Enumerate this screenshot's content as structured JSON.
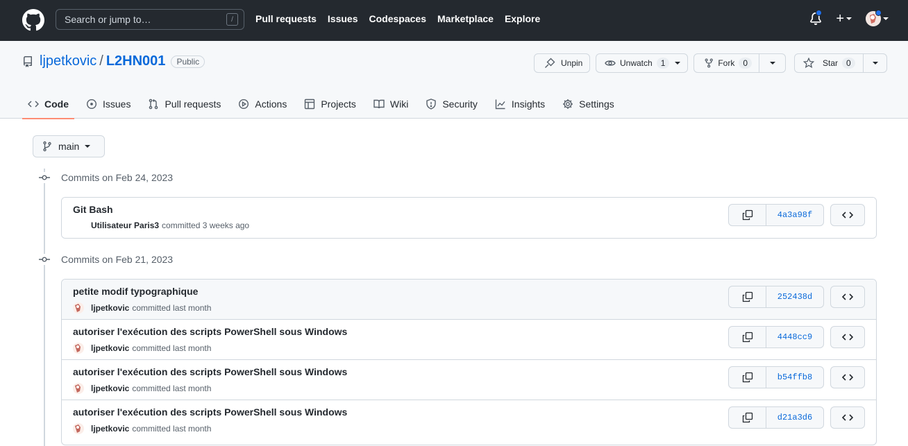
{
  "header": {
    "search_placeholder": "Search or jump to…",
    "search_key": "/",
    "nav": [
      "Pull requests",
      "Issues",
      "Codespaces",
      "Marketplace",
      "Explore"
    ]
  },
  "repo": {
    "owner": "ljpetkovic",
    "separator": "/",
    "name": "L2HN001",
    "visibility": "Public",
    "unpin_label": "Unpin",
    "unwatch_label": "Unwatch",
    "watch_count": "1",
    "fork_label": "Fork",
    "fork_count": "0",
    "star_label": "Star",
    "star_count": "0"
  },
  "tabs": [
    {
      "label": "Code",
      "icon": "code-icon",
      "selected": true
    },
    {
      "label": "Issues",
      "icon": "issue-icon"
    },
    {
      "label": "Pull requests",
      "icon": "pull-request-icon"
    },
    {
      "label": "Actions",
      "icon": "play-icon"
    },
    {
      "label": "Projects",
      "icon": "table-icon"
    },
    {
      "label": "Wiki",
      "icon": "book-icon"
    },
    {
      "label": "Security",
      "icon": "shield-icon"
    },
    {
      "label": "Insights",
      "icon": "graph-icon"
    },
    {
      "label": "Settings",
      "icon": "gear-icon"
    }
  ],
  "branch": "main",
  "groups": [
    {
      "date": "Commits on Feb 24, 2023",
      "commits": [
        {
          "title": "Git Bash",
          "author": "Utilisateur Paris3",
          "when": "committed 3 weeks ago",
          "sha": "4a3a98f",
          "avatar": false
        }
      ]
    },
    {
      "date": "Commits on Feb 21, 2023",
      "commits": [
        {
          "title": "petite modif typographique",
          "author": "ljpetkovic",
          "when": "committed last month",
          "sha": "252438d",
          "avatar": true,
          "hover": true
        },
        {
          "title": "autoriser l'exécution des scripts PowerShell sous Windows",
          "author": "ljpetkovic",
          "when": "committed last month",
          "sha": "4448cc9",
          "avatar": true
        },
        {
          "title": "autoriser l'exécution des scripts PowerShell sous Windows",
          "author": "ljpetkovic",
          "when": "committed last month",
          "sha": "b54ffb8",
          "avatar": true
        },
        {
          "title": "autoriser l'exécution des scripts PowerShell sous Windows",
          "author": "ljpetkovic",
          "when": "committed last month",
          "sha": "d21a3d6",
          "avatar": true
        }
      ]
    }
  ],
  "colors": {
    "header_bg": "#24292f",
    "link": "#0969da",
    "tab_underline": "#fd8c73",
    "notification_dot": "#1f6feb"
  }
}
